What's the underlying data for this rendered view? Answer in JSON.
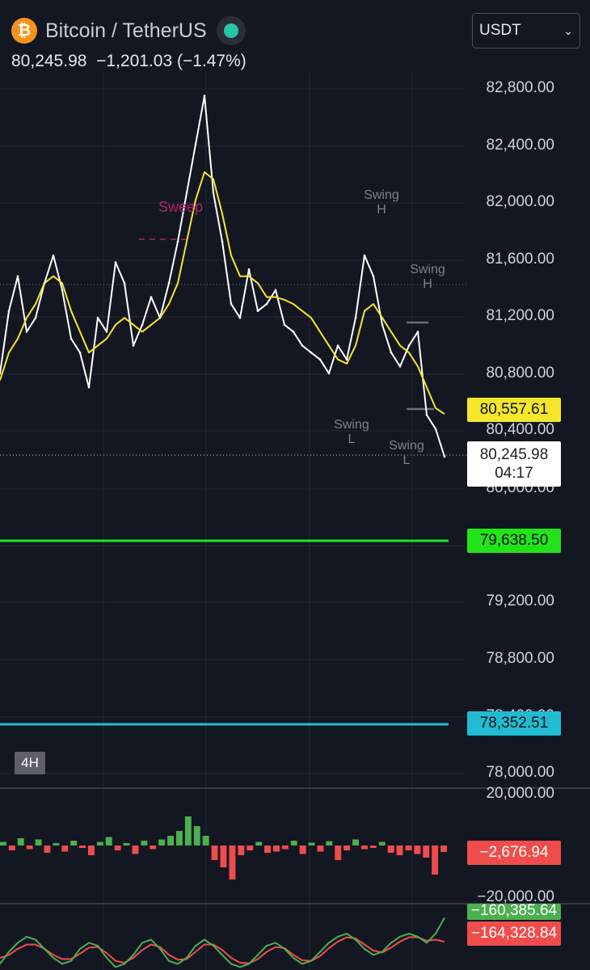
{
  "header": {
    "coin_icon_glyph": "₿",
    "pair_title": "Bitcoin / TetherUS",
    "last_price": "80,245.98",
    "change": "−1,201.03",
    "change_pct": "(−1.47%)",
    "live_status_color": "#26c6a6"
  },
  "quote_select": {
    "value": "USDT",
    "chevron_icon": "chevron-down-icon"
  },
  "timeframe_badge": "4H",
  "price_scale": [
    "82,800.00",
    "82,400.00",
    "82,000.00",
    "81,600.00",
    "81,200.00",
    "80,800.00",
    "80,400.00",
    "80,000.00",
    "79,200.00",
    "78,800.00",
    "78,400.00",
    "78,000.00"
  ],
  "price_tags": {
    "moving_average": {
      "value": "80,557.61",
      "bg": "#f5e62c",
      "fg": "#111111"
    },
    "current": {
      "value": "80,245.98",
      "countdown": "04:17"
    },
    "support_green": {
      "value": "79,638.50",
      "bg": "#22e31a",
      "fg": "#111111"
    },
    "support_cyan": {
      "value": "78,352.51",
      "bg": "#1fbcd3",
      "fg": "#111111"
    }
  },
  "annotations": {
    "sweep": "Sweep",
    "swing_high_1": {
      "line1": "Swing",
      "line2": "H"
    },
    "swing_high_2": {
      "line1": "Swing",
      "line2": "H"
    },
    "swing_low_1": {
      "line1": "Swing",
      "line2": "L"
    },
    "swing_low_2": {
      "line1": "Swing",
      "line2": "L"
    }
  },
  "histogram_pane": {
    "scale_top": "20,000.00",
    "scale_bottom": "−20,000.00",
    "value_tag": {
      "value": "−2,676.94",
      "bg": "#f04c4c",
      "fg": "#ffffff"
    },
    "positive_color": "#4caf50",
    "negative_color": "#f04c4c"
  },
  "line_pane": {
    "tag_green": {
      "value": "−160,385.64",
      "bg": "#4caf50",
      "fg": "#ffffff"
    },
    "tag_red": {
      "value": "−164,328.84",
      "bg": "#f04c4c",
      "fg": "#ffffff"
    }
  },
  "chart_data": {
    "type": "line",
    "ylim": [
      77960,
      82900
    ],
    "price_series": [
      80850,
      81300,
      81550,
      81150,
      81250,
      81500,
      81700,
      81450,
      81100,
      81000,
      80750,
      81250,
      81150,
      81650,
      81500,
      81050,
      81200,
      81400,
      81250,
      81500,
      81800,
      82150,
      82500,
      82850,
      82150,
      81800,
      81350,
      81250,
      81600,
      81300,
      81350,
      81450,
      81200,
      81150,
      81050,
      81000,
      80950,
      80850,
      81050,
      80950,
      81250,
      81700,
      81550,
      81200,
      81000,
      80900,
      81050,
      81150,
      80550,
      80450,
      80250
    ],
    "ma_series": [
      80800,
      81000,
      81100,
      81250,
      81350,
      81500,
      81550,
      81500,
      81300,
      81150,
      81000,
      81050,
      81100,
      81200,
      81250,
      81200,
      81150,
      81200,
      81250,
      81350,
      81500,
      81800,
      82100,
      82300,
      82250,
      82000,
      81700,
      81550,
      81550,
      81500,
      81400,
      81400,
      81380,
      81350,
      81300,
      81250,
      81150,
      81050,
      80950,
      80920,
      81050,
      81300,
      81350,
      81250,
      81150,
      81050,
      81000,
      80900,
      80750,
      80600,
      80557
    ],
    "volume_delta_histogram": [
      1500,
      -2000,
      3000,
      -1500,
      2500,
      -3000,
      1000,
      -2500,
      2000,
      -1000,
      -4000,
      1500,
      3500,
      -2000,
      1000,
      -3500,
      2000,
      -1500,
      2500,
      4000,
      6000,
      12000,
      8000,
      4000,
      -6000,
      -9000,
      -14000,
      -4000,
      -2000,
      1500,
      -3000,
      -2500,
      -1500,
      2000,
      -3500,
      1200,
      -2500,
      1800,
      -6000,
      -2000,
      2500,
      -1500,
      -1000,
      1500,
      -3000,
      -4000,
      -2000,
      -3500,
      -5000,
      -12000,
      -2677
    ],
    "cumulative_line_1": [
      -168000,
      -166000,
      -164500,
      -163500,
      -164000,
      -165500,
      -167000,
      -168000,
      -167500,
      -165500,
      -164500,
      -165000,
      -167000,
      -168500,
      -168000,
      -166500,
      -164500,
      -164000,
      -165500,
      -167500,
      -168000,
      -167000,
      -165000,
      -164000,
      -165000,
      -166500,
      -168000,
      -168500,
      -168000,
      -166500,
      -165000,
      -164500,
      -165500,
      -167000,
      -168000,
      -167500,
      -166000,
      -164500,
      -163500,
      -163000,
      -164000,
      -165500,
      -166500,
      -166000,
      -164500,
      -163500,
      -163000,
      -163500,
      -164500,
      -163000,
      -160385
    ],
    "cumulative_line_2": [
      -167000,
      -166500,
      -165500,
      -164800,
      -164800,
      -165500,
      -166500,
      -167200,
      -167200,
      -166300,
      -165300,
      -165200,
      -166200,
      -167500,
      -167800,
      -167000,
      -165700,
      -164800,
      -165200,
      -166500,
      -167300,
      -167200,
      -166000,
      -164800,
      -164800,
      -165700,
      -167000,
      -167800,
      -167900,
      -167200,
      -166000,
      -165200,
      -165400,
      -166500,
      -167400,
      -167500,
      -166700,
      -165400,
      -164300,
      -163600,
      -163800,
      -164800,
      -165800,
      -166100,
      -165300,
      -164300,
      -163600,
      -163600,
      -164200,
      -164000,
      -164328
    ]
  }
}
